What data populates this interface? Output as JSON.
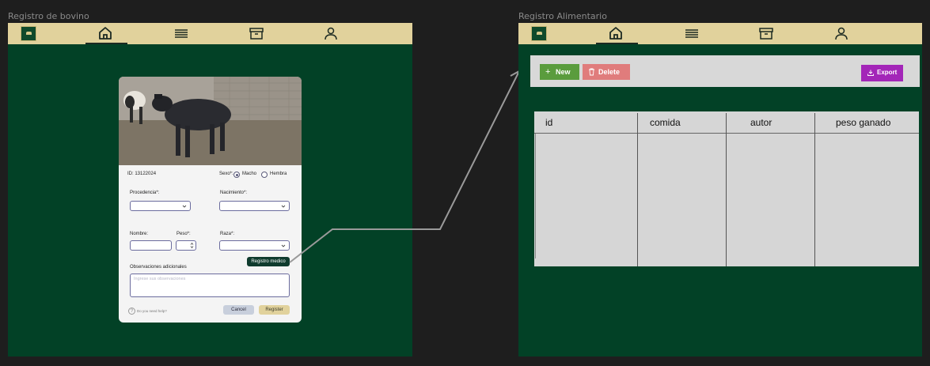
{
  "frames": {
    "left": {
      "label": "Registro de bovino"
    },
    "right": {
      "label": "Registro Alimentario"
    }
  },
  "navbar": {
    "icons": [
      "logo-icon",
      "home-icon",
      "menu-icon",
      "archive-icon",
      "user-icon"
    ],
    "active": "home-icon",
    "colors": {
      "background": "#e1d29c",
      "frame": "#024126",
      "logo": "#0f4a2b"
    }
  },
  "form": {
    "id_label": "ID: 13122024",
    "sexo_label": "Sexo*:",
    "sexo_options": [
      "Macho",
      "Hembra"
    ],
    "sexo_selected": "Macho",
    "procedencia_label": "Procedencia*:",
    "nacimiento_label": "Nacimiento*:",
    "nombre_label": "Nombre:",
    "peso_label": "Peso*:",
    "raza_label": "Raza*:",
    "registro_medico_button": "Registro medico",
    "observaciones_label": "Observaciones adicionales",
    "observaciones_placeholder": "Ingrese sus observaciones",
    "help_text": "Do you need help?",
    "cancel_button": "Cancel",
    "register_button": "Register",
    "colors": {
      "cancel": "#c8cfdc",
      "register": "#e1d29c",
      "registro_medico": "#0f3b2e"
    }
  },
  "alimentario": {
    "toolbar": {
      "new_label": "New",
      "delete_label": "Delete",
      "export_label": "Export",
      "colors": {
        "new": "#5a9c3d",
        "delete": "#e07c7c",
        "export": "#a326b8"
      }
    },
    "table": {
      "columns": [
        "id",
        "comida",
        "autor",
        "peso ganado"
      ],
      "rows": []
    }
  }
}
